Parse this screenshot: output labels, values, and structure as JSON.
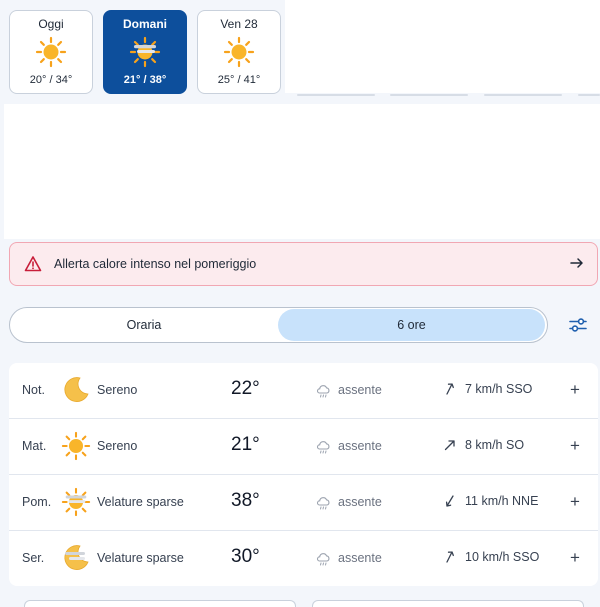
{
  "days": [
    {
      "name": "Oggi",
      "temp": "20° / 34°",
      "icon": "sun-icon",
      "selected": false
    },
    {
      "name": "Domani",
      "temp": "21° / 38°",
      "icon": "sun-haze-icon",
      "selected": true
    },
    {
      "name": "Ven 28",
      "temp": "25° / 41°",
      "icon": "sun-icon",
      "selected": false
    }
  ],
  "alert": {
    "text": "Allerta calore intenso nel pomeriggio",
    "icon": "warning-triangle-icon",
    "arrow": "arrow-right-icon"
  },
  "toggle": {
    "options": [
      "Oraria",
      "6 ore"
    ],
    "active": "6 ore"
  },
  "rows": [
    {
      "period": "Not.",
      "condition": "Sereno",
      "temp": "22°",
      "rain": "assente",
      "wind": "7 km/h SSO",
      "icon": "moon-icon",
      "wind_dir": "SSO"
    },
    {
      "period": "Mat.",
      "condition": "Sereno",
      "temp": "21°",
      "rain": "assente",
      "wind": "8 km/h SO",
      "icon": "sun-icon",
      "wind_dir": "SO"
    },
    {
      "period": "Pom.",
      "condition": "Velature sparse",
      "temp": "38°",
      "rain": "assente",
      "wind": "11 km/h NNE",
      "icon": "sun-haze-icon",
      "wind_dir": "NNE"
    },
    {
      "period": "Ser.",
      "condition": "Velature sparse",
      "temp": "30°",
      "rain": "assente",
      "wind": "10 km/h SSO",
      "icon": "sunset-haze-icon",
      "wind_dir": "SSO"
    }
  ],
  "colors": {
    "accent": "#0d4f9c",
    "toggle_active": "#c8e2fb",
    "alert_bg": "#fcebee",
    "sun": "#f7a21b"
  }
}
